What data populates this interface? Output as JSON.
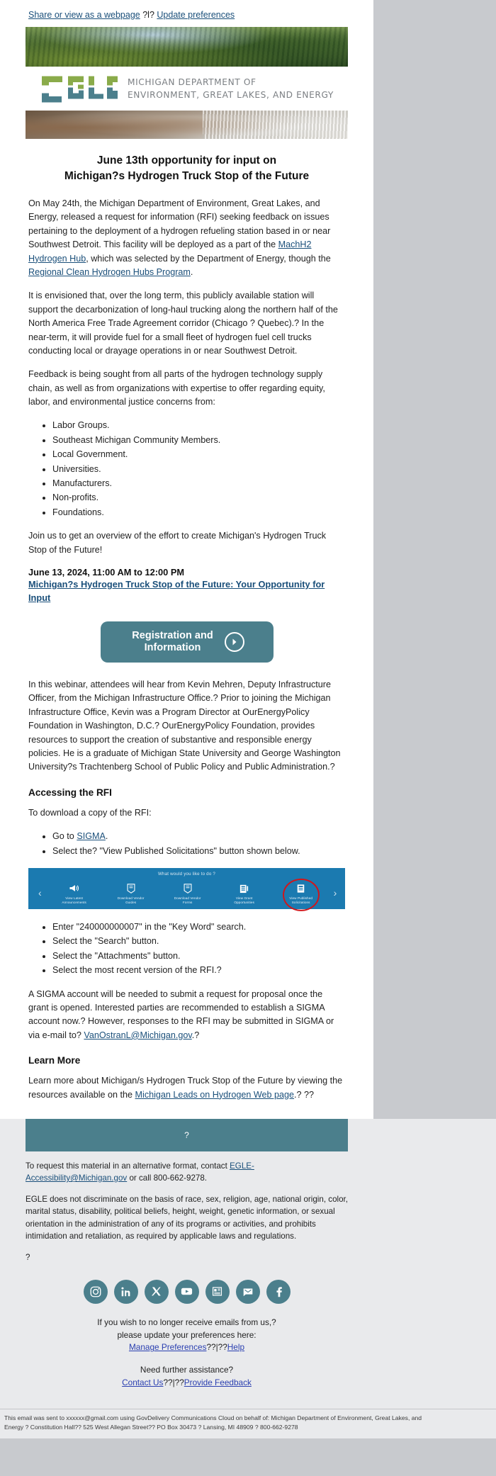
{
  "preheader": {
    "share_link": "Share or view as a webpage",
    "separator": "?l?",
    "update_link": "Update preferences"
  },
  "brand": {
    "logo_text": "EGLE",
    "dept_line1": "MICHIGAN DEPARTMENT OF",
    "dept_line2": "ENVIRONMENT, GREAT LAKES, AND ENERGY",
    "logo_green": "#8aab4a",
    "logo_teal": "#4b7f8c",
    "accent_teal": "#4b7f8c"
  },
  "article": {
    "title_line1": "June 13th opportunity for input on",
    "title_line2": "Michigan?s Hydrogen Truck Stop of the Future",
    "p1_a": "On May 24th, the Michigan Department of Environment, Great Lakes, and Energy, released a request for information (RFI) seeking feedback on issues pertaining to the deployment of a hydrogen refueling station based in or near Southwest Detroit. This facility will be deployed as a part of the ",
    "p1_link1": "MachH2 Hydrogen Hub",
    "p1_b": ", which was selected by the Department of Energy, though the ",
    "p1_link2": "Regional Clean Hydrogen Hubs Program",
    "p1_c": ".",
    "p2": "It is envisioned that, over the long term, this publicly available station will support the decarbonization of long-haul trucking along the northern half of the North America Free Trade Agreement corridor (Chicago ? Quebec).? In the near-term, it will provide fuel for a small fleet of hydrogen fuel cell trucks conducting local or drayage operations in or near Southwest Detroit.",
    "p3": "Feedback is being sought from all parts of the hydrogen technology supply chain, as well as from organizations with expertise to offer regarding equity, labor, and environmental justice concerns from:",
    "audience": [
      "Labor Groups.",
      "Southeast Michigan Community Members.",
      "Local Government.",
      "Universities.",
      "Manufacturers.",
      "Non-profits.",
      "Foundations."
    ],
    "p4": "Join us to get an overview of the effort to create Michigan's Hydrogen Truck Stop of the Future!",
    "event_datetime": "June 13, 2024, 11:00 AM to 12:00 PM",
    "event_link": "Michigan?s Hydrogen Truck Stop of the Future: Your Opportunity for Input",
    "cta_label_line1": "Registration and",
    "cta_label_line2": "Information",
    "p5": "In this webinar, attendees will hear from Kevin Mehren, Deputy Infrastructure Officer, from the Michigan Infrastructure Office.? Prior to joining the Michigan Infrastructure Office, Kevin was a Program Director at OurEnergyPolicy Foundation in Washington, D.C.? OurEnergyPolicy Foundation, provides resources to support the creation of substantive and responsible energy policies. He is a graduate of Michigan State University and George Washington University?s Trachtenberg School of Public Policy and Public Administration.?",
    "h_accessing": "Accessing the RFI",
    "p6": "To download a copy of the RFI:",
    "steps_first": [
      {
        "pre": "Go to ",
        "link": "SIGMA",
        "post": "."
      },
      {
        "pre": "Select the? \"View Published Solicitations\" button shown below.",
        "link": "",
        "post": ""
      }
    ],
    "steps_after": [
      "Enter \"240000000007\" in the \"Key Word\" search.",
      "Select the \"Search\" button.",
      "Select the \"Attachments\" button.",
      "Select the most recent version of the RFI.?"
    ],
    "p7_a": "A SIGMA account will be needed to submit a request for proposal once the grant is opened. Interested parties are recommended to establish a SIGMA account now.? However, responses to the RFI may be submitted in SIGMA or via e-mail to? ",
    "p7_link": "VanOstranL@Michigan.gov",
    "p7_b": ".?",
    "h_learn": "Learn More",
    "p8_a": "Learn more about Michigan/s Hydrogen Truck Stop of the Future by viewing the resources available on the ",
    "p8_link": "Michigan Leads on Hydrogen Web page",
    "p8_b": ".? ??"
  },
  "sigma_widget": {
    "prompt": "What would you like to do ?",
    "prev_arrow": "‹",
    "next_arrow": "›",
    "items": [
      {
        "icon": "megaphone-icon",
        "line1": "View Latest",
        "line2": "Announcements"
      },
      {
        "icon": "document-guide-icon",
        "line1": "Download Vendor",
        "line2": "Guides"
      },
      {
        "icon": "document-form-icon",
        "line1": "Download Vendor",
        "line2": "Forms"
      },
      {
        "icon": "grant-opportunity-icon",
        "line1": "View Grant",
        "line2": "Opportunities"
      },
      {
        "icon": "published-solicitations-icon",
        "line1": "View Published",
        "line2": "Solicitations"
      }
    ],
    "highlight_index": 4,
    "highlight_color": "#d0161b",
    "bar_color": "#1b7ab0"
  },
  "footer": {
    "band_text": "?",
    "accessibility_pre": "To request this material in an alternative format, contact ",
    "accessibility_link": "EGLE-Accessibility@Michigan.gov",
    "accessibility_post": " or call 800-662-9278.",
    "nondiscrimination": "EGLE does not discriminate on the basis of race, sex, religion, age, national origin, color, marital status, disability, political beliefs, height, weight, genetic information, or sexual orientation in the administration of any of its programs or activities, and prohibits intimidation and retaliation, as required by applicable laws and regulations.",
    "stray_q": "?",
    "social": [
      {
        "name": "instagram-icon",
        "glyph": "instagram"
      },
      {
        "name": "linkedin-icon",
        "glyph": "in"
      },
      {
        "name": "x-twitter-icon",
        "glyph": "X"
      },
      {
        "name": "youtube-icon",
        "glyph": "youtube"
      },
      {
        "name": "newsletter-icon",
        "glyph": "news"
      },
      {
        "name": "email-icon",
        "glyph": "mail"
      },
      {
        "name": "facebook-icon",
        "glyph": "f"
      }
    ],
    "unsub_line1": "If you wish to no longer receive emails from us,?",
    "unsub_line2": "please update your preferences here:",
    "manage_link": "Manage Preferences",
    "manage_sep": "??|??",
    "help_link": "Help",
    "assist_line": "Need further assistance?",
    "contact_link": "Contact Us",
    "contact_sep": "??|??",
    "feedback_link": "Provide Feedback",
    "legal_line1": "This email was sent to xxxxxx@gmail.com using GovDelivery Communications Cloud on behalf of: Michigan Department of Environment, Great Lakes, and",
    "legal_line2": "Energy ? Constitution Hall?? 525 West Allegan Street?? PO Box 30473 ? Lansing, MI 48909 ? 800-662-9278"
  }
}
